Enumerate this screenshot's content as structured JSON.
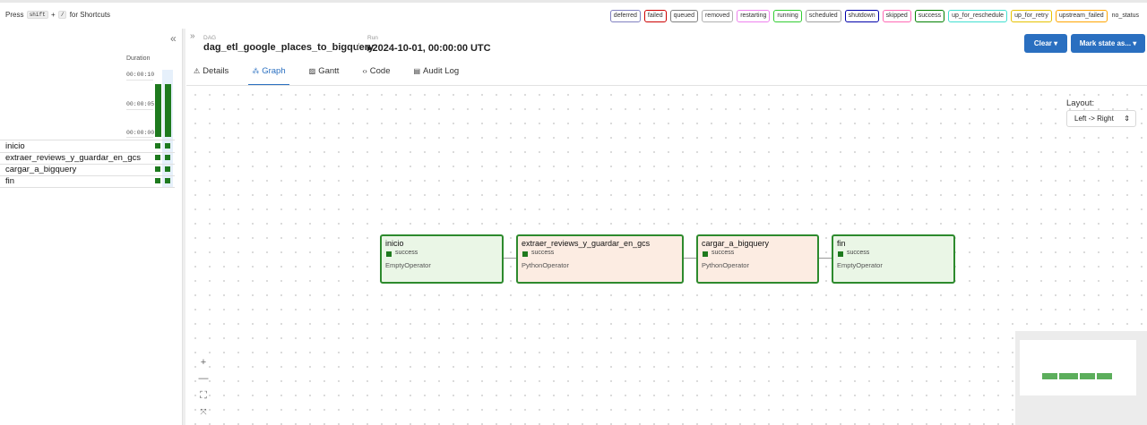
{
  "shortcut_hint": {
    "press": "Press",
    "key1": "shift",
    "plus": "+",
    "key2": "/",
    "suffix": "for Shortcuts"
  },
  "legend": [
    {
      "label": "deferred",
      "color": "#8080c0"
    },
    {
      "label": "failed",
      "color": "#cc0000"
    },
    {
      "label": "queued",
      "color": "#808080"
    },
    {
      "label": "removed",
      "color": "#b0b0b0"
    },
    {
      "label": "restarting",
      "color": "#ee82ee"
    },
    {
      "label": "running",
      "color": "#32cd32"
    },
    {
      "label": "scheduled",
      "color": "#a0a0a0"
    },
    {
      "label": "shutdown",
      "color": "#0000aa"
    },
    {
      "label": "skipped",
      "color": "#ff69b4"
    },
    {
      "label": "success",
      "color": "#008000"
    },
    {
      "label": "up_for_reschedule",
      "color": "#40e0d0"
    },
    {
      "label": "up_for_retry",
      "color": "#e6c200"
    },
    {
      "label": "upstream_failed",
      "color": "#ffa500"
    },
    {
      "label": "no_status",
      "color": ""
    }
  ],
  "grid": {
    "duration_label": "Duration",
    "ticks": [
      "00:00:10",
      "00:00:05",
      "00:00:00"
    ],
    "run_durations": [
      0.85,
      0.85
    ],
    "tasks": [
      "inicio",
      "extraer_reviews_y_guardar_en_gcs",
      "cargar_a_bigquery",
      "fin"
    ]
  },
  "breadcrumb": {
    "dag_label": "DAG",
    "dag_id": "dag_etl_google_places_to_bigquery",
    "run_label": "Run",
    "run_id": "▸2024-10-01, 00:00:00 UTC"
  },
  "buttons": {
    "clear": "Clear ▾",
    "mark_state": "Mark state as... ▾"
  },
  "tabs": [
    {
      "icon": "⚠",
      "label": "Details"
    },
    {
      "icon": "⁂",
      "label": "Graph"
    },
    {
      "icon": "▨",
      "label": "Gantt"
    },
    {
      "icon": "‹›",
      "label": "Code"
    },
    {
      "icon": "▤",
      "label": "Audit Log"
    }
  ],
  "layout": {
    "label": "Layout:",
    "value": "Left -> Right"
  },
  "nodes": [
    {
      "name": "inicio",
      "status": "success",
      "operator": "EmptyOperator"
    },
    {
      "name": "extraer_reviews_y_guardar_en_gcs",
      "status": "success",
      "operator": "PythonOperator"
    },
    {
      "name": "cargar_a_bigquery",
      "status": "success",
      "operator": "PythonOperator"
    },
    {
      "name": "fin",
      "status": "success",
      "operator": "EmptyOperator"
    }
  ],
  "zoom_controls": {
    "zoom_in": "+",
    "zoom_out": "—",
    "fit": "⛶",
    "lock": "⤧"
  },
  "colors": {
    "accent": "#2a6fc0",
    "success": "#1e7a1e"
  }
}
